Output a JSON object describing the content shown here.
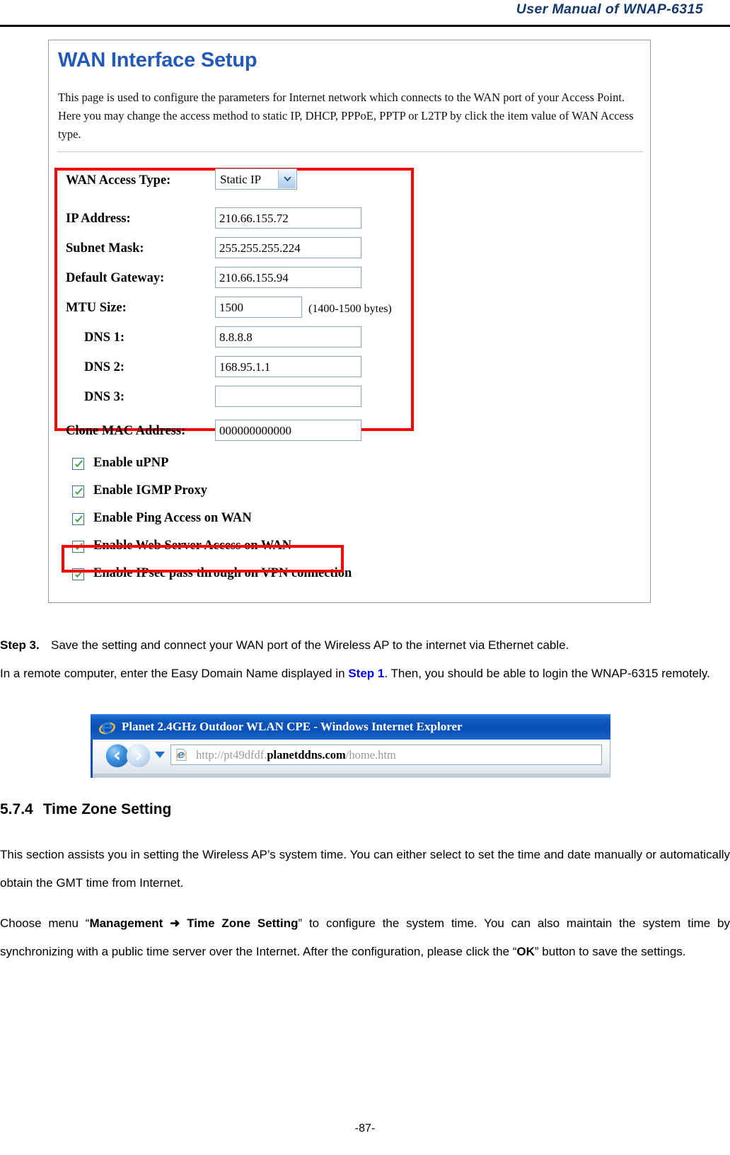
{
  "header": {
    "title": "User  Manual  of  WNAP-6315"
  },
  "footer": {
    "page_number": "-87-"
  },
  "wan_screenshot": {
    "title": "WAN Interface Setup",
    "description": "This page is used to configure the parameters for Internet network which connects to the WAN port of your Access Point. Here you may change the access method to static IP, DHCP, PPPoE, PPTP or L2TP by click the item value of WAN Access type.",
    "access_type": {
      "label": "WAN Access Type:",
      "value": "Static IP",
      "icon": "chevron-down-icon"
    },
    "fields": [
      {
        "label": "IP Address:",
        "value": "210.66.155.72",
        "hint": "",
        "indent": false,
        "narrow": false
      },
      {
        "label": "Subnet Mask:",
        "value": "255.255.255.224",
        "hint": "",
        "indent": false,
        "narrow": false
      },
      {
        "label": "Default Gateway:",
        "value": "210.66.155.94",
        "hint": "",
        "indent": false,
        "narrow": false
      },
      {
        "label": "MTU Size:",
        "value": "1500",
        "hint": "(1400-1500 bytes)",
        "indent": false,
        "narrow": true
      },
      {
        "label": "DNS 1:",
        "value": "8.8.8.8",
        "hint": "",
        "indent": true,
        "narrow": false
      },
      {
        "label": "DNS 2:",
        "value": "168.95.1.1",
        "hint": "",
        "indent": true,
        "narrow": false
      },
      {
        "label": "DNS 3:",
        "value": "",
        "hint": "",
        "indent": true,
        "narrow": false
      }
    ],
    "clone_mac": {
      "label": "Clone MAC Address:",
      "value": "000000000000"
    },
    "checkboxes": [
      {
        "label": "Enable uPNP",
        "checked": true,
        "highlighted": false
      },
      {
        "label": "Enable IGMP Proxy",
        "checked": true,
        "highlighted": false
      },
      {
        "label": "Enable Ping Access on WAN",
        "checked": true,
        "highlighted": false
      },
      {
        "label": "Enable Web Server Access on WAN",
        "checked": true,
        "highlighted": true
      },
      {
        "label": "Enable IPsec pass through on VPN connection",
        "checked": true,
        "highlighted": false
      }
    ],
    "highlight_color": "#ff0000",
    "title_color": "#2359b8",
    "check_color": "#3ba93b"
  },
  "step3": {
    "label": "Step 3.",
    "text": "Save the setting and connect your WAN port of the Wireless AP to the internet via Ethernet cable."
  },
  "remote_note": {
    "part1": "In a remote computer, enter the Easy Domain Name displayed in ",
    "step_link": "Step 1",
    "part2": ". Then, you should be able to login the WNAP-6315 remotely."
  },
  "ie_screenshot": {
    "window_title": "Planet 2.4GHz Outdoor WLAN CPE - Windows Internet Explorer",
    "logo_icon": "internet-explorer-icon",
    "back_icon": "back-arrow-icon",
    "forward_icon": "forward-arrow-icon",
    "dropdown_icon": "chevron-down-icon",
    "address_icon": "page-icon",
    "url_prefix": "http://pt49dfdf.",
    "url_host": "planetddns.com",
    "url_suffix": "/home.htm",
    "titlebar_color": "#0a4fb4"
  },
  "section": {
    "number": "5.7.4",
    "title": "Time Zone Setting",
    "paragraph1": "This section assists you in setting the Wireless AP’s system time. You can either select to set the time and date manually or automatically obtain the GMT time from Internet.",
    "paragraph2_a": "Choose menu “",
    "paragraph2_menu": "Management ➜ Time Zone Setting",
    "paragraph2_b": "” to configure the system time. You can also maintain the system time by synchronizing with a public time server over the Internet. After the configuration, please click the “",
    "paragraph2_ok": "OK",
    "paragraph2_c": "” button to save the settings."
  }
}
